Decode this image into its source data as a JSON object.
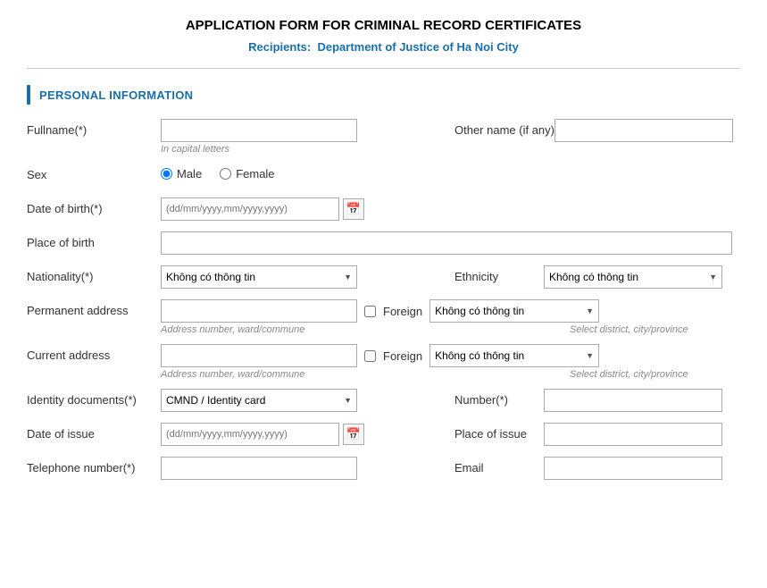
{
  "page": {
    "title": "APPLICATION FORM FOR CRIMINAL RECORD CERTIFICATES",
    "recipients_label": "Recipients:",
    "recipients_value": "Department of Justice of Ha Noi City"
  },
  "section": {
    "personal_info": "PERSONAL INFORMATION"
  },
  "fields": {
    "fullname_label": "Fullname(*)",
    "fullname_hint": "In capital letters",
    "othername_label": "Other name (if any)",
    "sex_label": "Sex",
    "sex_male": "Male",
    "sex_female": "Female",
    "dob_label": "Date of birth(*)",
    "dob_placeholder": "(dd/mm/yyyy,mm/yyyy,yyyy)",
    "place_of_birth_label": "Place of birth",
    "nationality_label": "Nationality(*)",
    "nationality_default": "Không có thông tin",
    "ethnicity_label": "Ethnicity",
    "ethnicity_default": "Không có thông tin",
    "permanent_address_label": "Permanent address",
    "permanent_address_hint": "Address number, ward/commune",
    "permanent_foreign_label": "Foreign",
    "permanent_foreign_select": "Không có thông tin",
    "permanent_foreign_hint": "Select district, city/province",
    "current_address_label": "Current address",
    "current_address_hint": "Address number, ward/commune",
    "current_foreign_label": "Foreign",
    "current_foreign_select": "Không có thông tin",
    "current_foreign_hint": "Select district, city/province",
    "identity_docs_label": "Identity documents(*)",
    "identity_docs_default": "CMND / Identity card",
    "number_label": "Number(*)",
    "date_of_issue_label": "Date of issue",
    "date_of_issue_placeholder": "(dd/mm/yyyy,mm/yyyy,yyyy)",
    "place_of_issue_label": "Place of issue",
    "telephone_label": "Telephone number(*)",
    "email_label": "Email"
  }
}
